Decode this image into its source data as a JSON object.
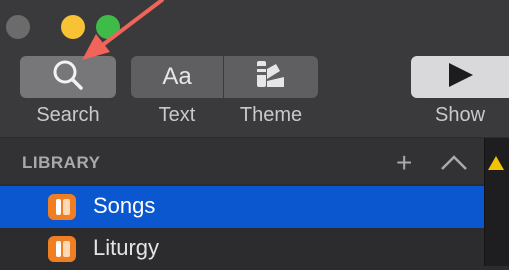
{
  "toolbar": {
    "search_label": "Search",
    "text_label": "Text",
    "text_icon_glyph": "Aa",
    "theme_label": "Theme",
    "show_label": "Show"
  },
  "library": {
    "title": "LIBRARY",
    "items": [
      {
        "label": "Songs",
        "selected": true,
        "icon": "library-folder-icon"
      },
      {
        "label": "Liturgy",
        "selected": false,
        "icon": "library-folder-icon"
      }
    ]
  },
  "colors": {
    "selection": "#0a57d0",
    "annotation_arrow": "#f0645a",
    "folder_icon": "#f07f24"
  }
}
